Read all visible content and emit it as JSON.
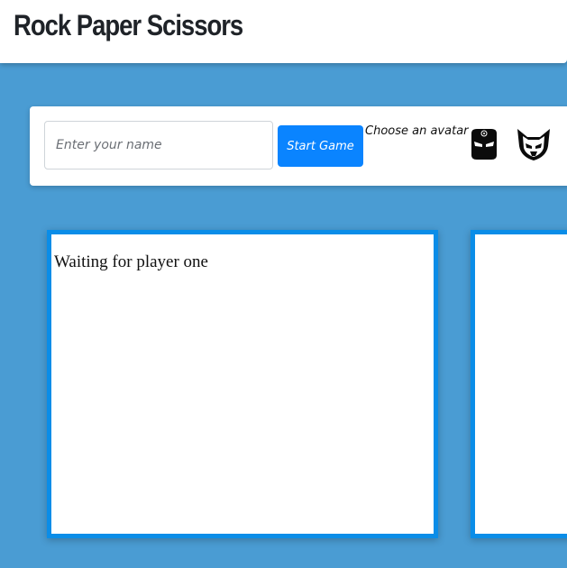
{
  "app": {
    "title": "Rock Paper Scissors"
  },
  "controls": {
    "name_input": {
      "placeholder": "Enter your name",
      "value": ""
    },
    "start_button_label": "Start Game",
    "avatar_label": "Choose an avatar",
    "avatars": [
      {
        "name": "ninja-mask-icon"
      },
      {
        "name": "wolverine-mask-icon"
      }
    ]
  },
  "panels": {
    "player_one": {
      "status": "Waiting for player one"
    },
    "player_two": {
      "status": ""
    }
  },
  "colors": {
    "background": "#4a9cd3",
    "accent": "#0a84ff",
    "panel_border": "#0a8de8"
  }
}
